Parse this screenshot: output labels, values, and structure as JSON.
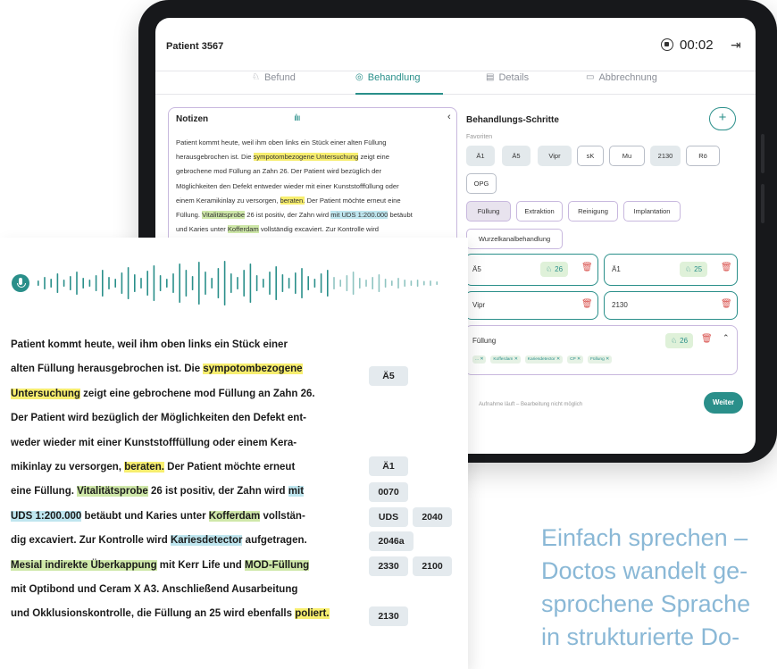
{
  "app": {
    "patient_title": "Patient 3567",
    "timer": "00:02",
    "tabs": [
      {
        "label": "Befund"
      },
      {
        "label": "Behandlung"
      },
      {
        "label": "Details"
      },
      {
        "label": "Abbrechnung"
      }
    ],
    "active_tab": "Behandlung"
  },
  "notes": {
    "title": "Notizen",
    "text": [
      "Patient kommt heute, weil ihm oben links ein Stück einer alten Füllung",
      [
        "herausgebrochen ist. Die ",
        "sympotombezogene Untersuchung",
        " zeigt eine"
      ],
      "gebrochene mod Füllung an Zahn 26. Der Patient wird bezüglich der",
      "Möglichkeiten den Defekt entweder wieder mit einer Kunststofffüllung oder",
      [
        "einem Keramikinlay zu versorgen, ",
        "beraten.",
        " Der Patient möchte erneut eine"
      ],
      [
        "Füllung. ",
        "Vitalitätsprobe",
        " 26 ist positiv, der Zahn wird ",
        "mit UDS 1:200.000",
        " betäubt"
      ],
      [
        "und Karies unter ",
        "Kofferdam",
        " vollständig excaviert. Zur Kontrolle wird"
      ]
    ]
  },
  "steps": {
    "title": "Behandlungs-Schritte",
    "add_label": "+",
    "favorites_label": "Favoriten",
    "favorites": [
      "Ä1",
      "Ä5",
      "Vipr",
      "sK",
      "Mu",
      "2130",
      "Rö",
      "OPG"
    ],
    "categories": [
      "Füllung",
      "Extraktion",
      "Reinigung",
      "Implantation",
      "Wurzelkanalbehandlung"
    ],
    "cards": [
      {
        "name": "Ä5",
        "count": "26"
      },
      {
        "name": "Ä1",
        "count": "25"
      },
      {
        "name": "Vipr"
      },
      {
        "name": "2130"
      }
    ],
    "group": {
      "name": "Füllung",
      "count": "26",
      "tags": [
        "...",
        "Kofferdam",
        "Kariesdetector",
        "CP",
        "Füllung"
      ]
    },
    "footer_hint": "Aufnahme läuft – Bearbeitung nicht möglich",
    "next_label": "Weiter"
  },
  "dictation": {
    "lines": [
      [
        "Patient kommt heute, weil ihm oben links ein Stück einer"
      ],
      [
        "alten Füllung herausgebrochen ist. Die ",
        "sympotombezogene"
      ],
      [
        "Untersuchung",
        " zeigt eine gebrochene mod Füllung an Zahn 26."
      ],
      [
        "Der Patient wird bezüglich der Möglichkeiten den Defekt ent-"
      ],
      [
        "weder wieder mit einer Kunststofffüllung oder einem Kera-"
      ],
      [
        "mikinlay zu versorgen, ",
        "beraten.",
        " Der Patient möchte erneut"
      ],
      [
        "eine Füllung. ",
        "Vitalitätsprobe",
        " 26 ist positiv, der Zahn wird ",
        "mit"
      ],
      [
        "UDS 1:200.000",
        " betäubt und Karies unter ",
        "Kofferdam",
        " vollstän-"
      ],
      [
        "dig excaviert. Zur Kontrolle wird ",
        "Kariesdetector",
        " aufgetragen."
      ],
      [
        "Mesial indirekte Überkappung",
        " mit Kerr Life und ",
        "MOD-Füllung"
      ],
      [
        "mit Optibond und Ceram X A3. Anschließend Ausarbeitung"
      ],
      [
        "und Okklusionskontrolle, die Füllung an 25 wird ebenfalls ",
        "poliert."
      ]
    ],
    "codes": [
      "Ä5",
      "Ä1",
      "0070",
      "UDS",
      "2040",
      "2046a",
      "2330",
      "2100",
      "2130"
    ]
  },
  "slogan": [
    "Einfach sprechen –",
    "Doctos wandelt ge-",
    "sprochene Sprache",
    "in strukturierte Do-"
  ],
  "colors": {
    "accent": "#2a8f8a",
    "purple_outline": "#c8b8de",
    "highlight_yellow": "#f7ee6f",
    "highlight_green": "#cfe8a9",
    "highlight_blue": "#bfe6ef",
    "slogan": "#8ab8d6",
    "delete": "#d9534f"
  },
  "icons": {
    "record": "record-stop-icon",
    "exit": "exit-icon",
    "mic": "microphone-icon",
    "tooth": "tooth-icon",
    "trash": "trash-icon"
  }
}
